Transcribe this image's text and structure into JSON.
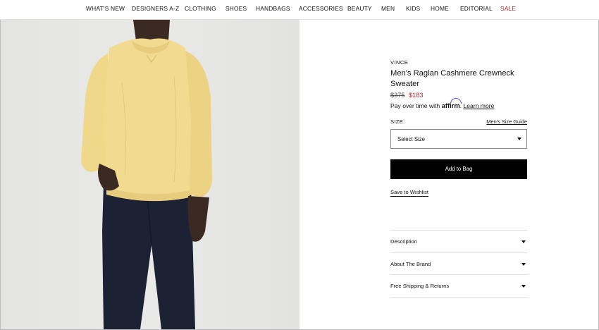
{
  "nav": {
    "items": [
      "WHAT'S NEW",
      "DESIGNERS A-Z",
      "CLOTHING",
      "SHOES",
      "HANDBAGS",
      "ACCESSORIES",
      "BEAUTY",
      "MEN",
      "KIDS",
      "HOME",
      "EDITORIAL",
      "SALE"
    ],
    "sale_color": "#b3282d"
  },
  "product": {
    "brand": "VINCE",
    "name": "Men's Raglan Cashmere Crewneck Sweater",
    "price_original": "$375",
    "price_sale": "$183",
    "affirm_prefix": "Pay over time with",
    "affirm_logo": "affirm",
    "affirm_suffix": ".",
    "learn_more": "Learn more",
    "size_label": "SIZE:",
    "size_guide": "Men's Size Guide",
    "size_select": "Select Size",
    "add_to_bag": "Add to Bag",
    "wishlist": "Save to Wishlist"
  },
  "accordion": [
    {
      "label": "Description"
    },
    {
      "label": "About The Brand"
    },
    {
      "label": "Free Shipping & Returns"
    }
  ],
  "image": {
    "subject": "model-wearing-yellow-sweater",
    "sweater_color": "#f1d98c",
    "pants_color": "#1c2233"
  }
}
